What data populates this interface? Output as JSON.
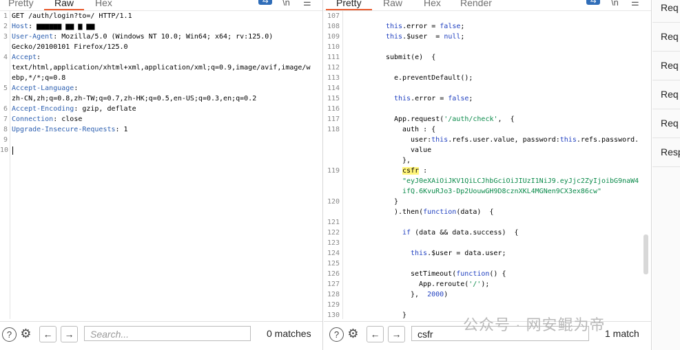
{
  "request": {
    "tabs": [
      "Pretty",
      "Raw",
      "Hex"
    ],
    "active_tab": "Raw",
    "lines": [
      {
        "n": "1",
        "t": "GET /auth/login?to=/ HTTP/1.1"
      },
      {
        "n": "2",
        "k": "Host",
        "v": "▆▆▆▆▆▆ ▆▆ ▆ ▆▆"
      },
      {
        "n": "3",
        "k": "User-Agent",
        "v": "Mozilla/5.0 (Windows NT 10.0; Win64; x64; rv:125.0)"
      },
      {
        "n": "",
        "t": "Gecko/20100101 Firefox/125.0"
      },
      {
        "n": "4",
        "k": "Accept",
        "v": ""
      },
      {
        "n": "",
        "t": "text/html,application/xhtml+xml,application/xml;q=0.9,image/avif,image/w"
      },
      {
        "n": "",
        "t": "ebp,*/*;q=0.8"
      },
      {
        "n": "5",
        "k": "Accept-Language",
        "v": ""
      },
      {
        "n": "",
        "t": "zh-CN,zh;q=0.8,zh-TW;q=0.7,zh-HK;q=0.5,en-US;q=0.3,en;q=0.2"
      },
      {
        "n": "6",
        "k": "Accept-Encoding",
        "v": "gzip, deflate"
      },
      {
        "n": "7",
        "k": "Connection",
        "v": "close"
      },
      {
        "n": "8",
        "k": "Upgrade-Insecure-Requests",
        "v": "1"
      },
      {
        "n": "9",
        "t": ""
      },
      {
        "n": "10",
        "t": ""
      }
    ],
    "search_placeholder": "Search...",
    "matches": "0 matches"
  },
  "response": {
    "tabs": [
      "Pretty",
      "Raw",
      "Hex",
      "Render"
    ],
    "active_tab": "Pretty",
    "search_value": "csfr",
    "matches": "1 match"
  },
  "side": {
    "items": [
      "Req",
      "Req",
      "Req",
      "Req",
      "Req",
      "Resp"
    ]
  },
  "watermark": "公众号 · 网安鲲为帝"
}
